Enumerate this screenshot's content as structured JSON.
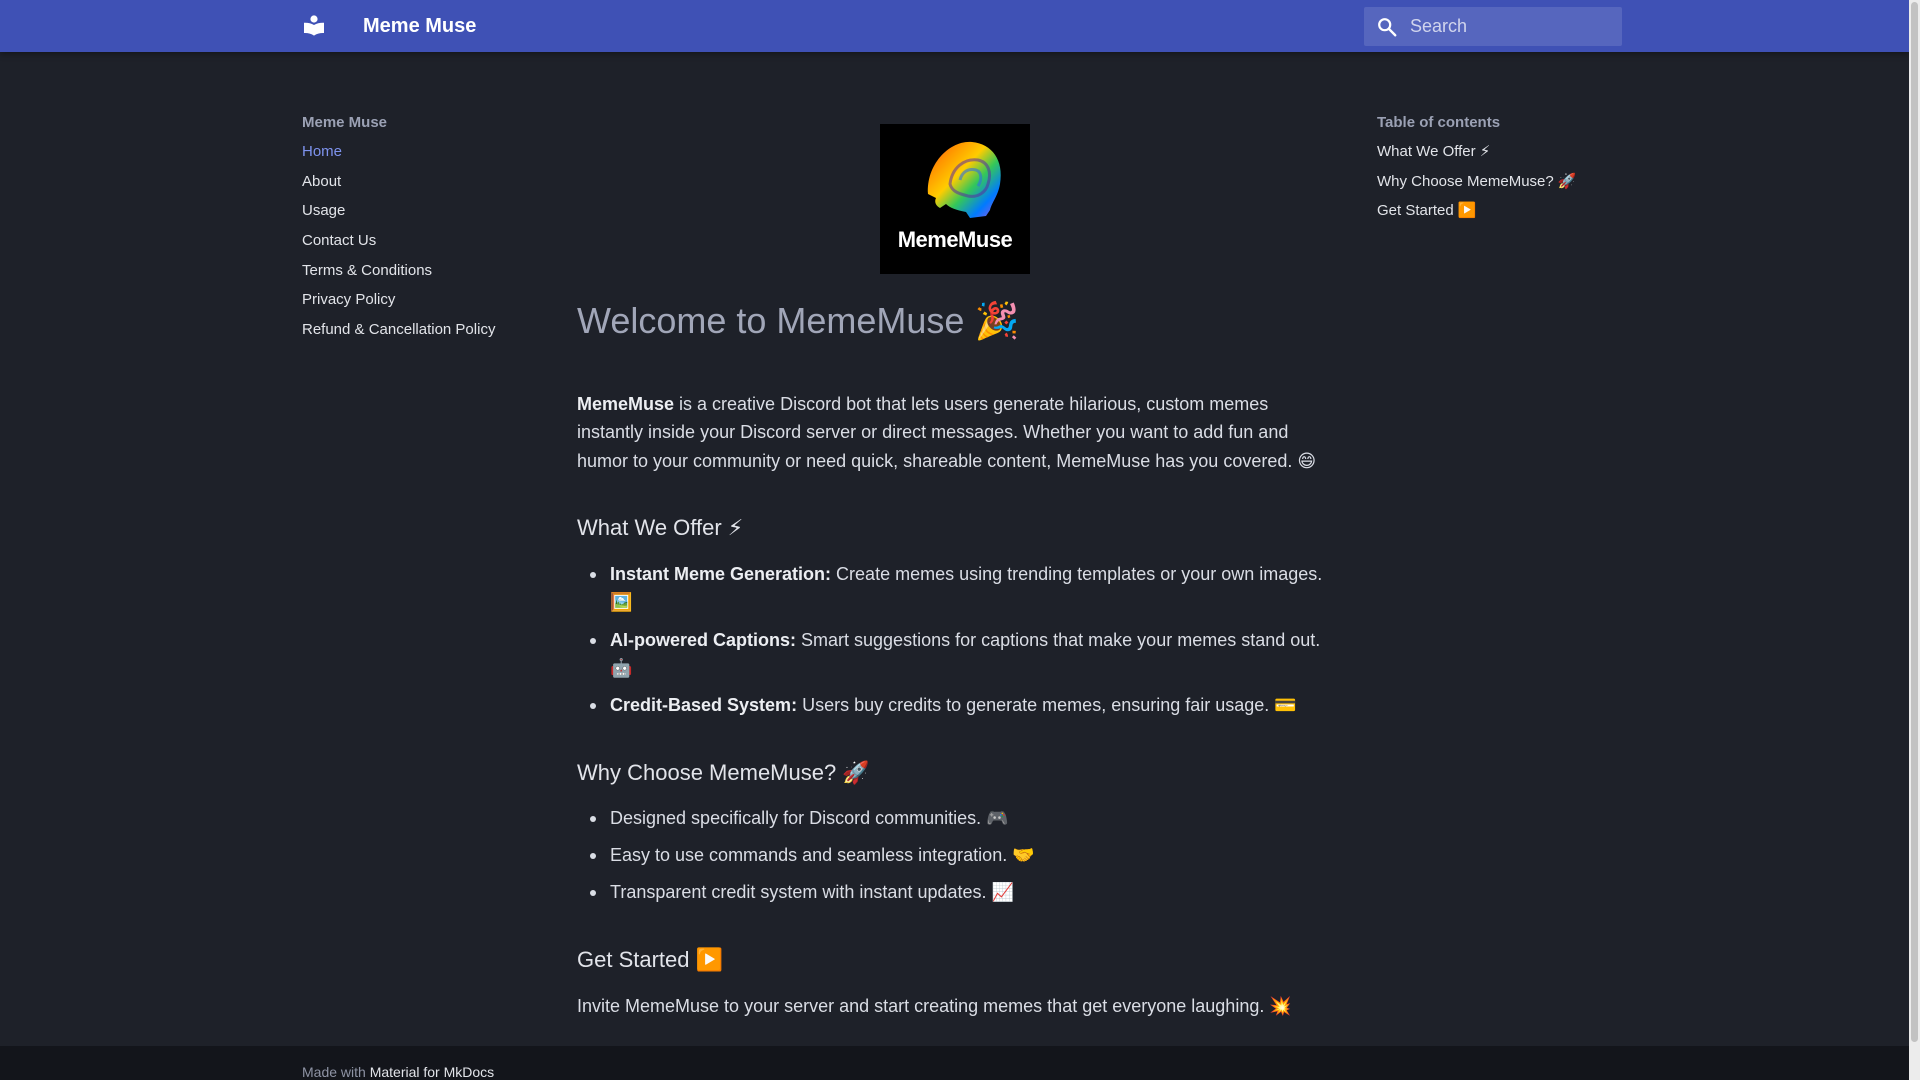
{
  "header": {
    "site_title": "Meme Muse",
    "logo_icon": "book-open-icon",
    "search_placeholder": "Search",
    "accent_color": "#3f51b5"
  },
  "nav": {
    "title": "Meme Muse",
    "items": [
      {
        "label": "Home",
        "active": true
      },
      {
        "label": "About"
      },
      {
        "label": "Usage"
      },
      {
        "label": "Contact Us"
      },
      {
        "label": "Terms & Conditions"
      },
      {
        "label": "Privacy Policy"
      },
      {
        "label": "Refund & Cancellation Policy"
      }
    ]
  },
  "toc": {
    "title": "Table of contents",
    "items": [
      {
        "label": "What We Offer ⚡"
      },
      {
        "label": "Why Choose MemeMuse? 🚀"
      },
      {
        "label": "Get Started ▶️"
      }
    ]
  },
  "content": {
    "logo_text": "MemeMuse",
    "title": "Welcome to MemeMuse 🎉",
    "intro_bold": "MemeMuse",
    "intro_text": " is a creative Discord bot that lets users generate hilarious, custom memes instantly inside your Discord server or direct messages. Whether you want to add fun and humor to your community or need quick, shareable content, MemeMuse has you covered. 😄",
    "offer": {
      "heading": "What We Offer ⚡",
      "items": [
        {
          "bold": "Instant Meme Generation:",
          "text": " Create memes using trending templates or your own images. 🖼️"
        },
        {
          "bold": "AI-powered Captions:",
          "text": " Smart suggestions for captions that make your memes stand out. 🤖"
        },
        {
          "bold": "Credit-Based System:",
          "text": " Users buy credits to generate memes, ensuring fair usage. 💳"
        }
      ]
    },
    "why": {
      "heading": "Why Choose MemeMuse? 🚀",
      "items": [
        {
          "text": "Designed specifically for Discord communities. 🎮"
        },
        {
          "text": "Easy to use commands and seamless integration. 🤝"
        },
        {
          "text": "Transparent credit system with instant updates. 📈"
        }
      ]
    },
    "start": {
      "heading": "Get Started ▶️",
      "text": "Invite MemeMuse to your server and start creating memes that get everyone laughing. 💥"
    }
  },
  "footer": {
    "prefix": "Made with ",
    "link": "Material for MkDocs"
  }
}
